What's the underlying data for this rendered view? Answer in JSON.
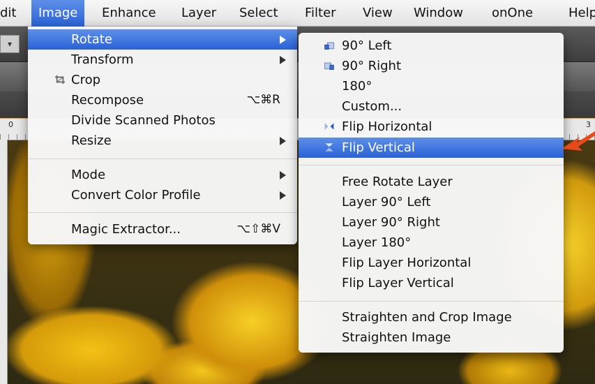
{
  "menubar": {
    "items": [
      "dit",
      "Image",
      "Enhance",
      "Layer",
      "Select",
      "Filter",
      "View",
      "Window",
      "onOne",
      "Help"
    ],
    "active": "Image"
  },
  "ruler": {
    "left_number": "0",
    "right_number": "3"
  },
  "image_menu": {
    "rotate": "Rotate",
    "transform": "Transform",
    "crop": "Crop",
    "recompose": "Recompose",
    "recompose_shortcut": "⌥⌘R",
    "divide_scanned": "Divide Scanned Photos",
    "resize": "Resize",
    "mode": "Mode",
    "convert_color_profile": "Convert Color Profile",
    "magic_extractor": "Magic Extractor...",
    "magic_extractor_shortcut": "⌥⇧⌘V"
  },
  "rotate_menu": {
    "left_90": "90° Left",
    "right_90": "90° Right",
    "r180": "180°",
    "custom": "Custom...",
    "flip_horizontal": "Flip Horizontal",
    "flip_vertical": "Flip Vertical",
    "free_rotate_layer": "Free Rotate Layer",
    "layer_90_left": "Layer 90° Left",
    "layer_90_right": "Layer 90° Right",
    "layer_180": "Layer 180°",
    "flip_layer_horizontal": "Flip Layer Horizontal",
    "flip_layer_vertical": "Flip Layer Vertical",
    "straighten_and_crop": "Straighten and Crop Image",
    "straighten_image": "Straighten Image"
  },
  "colors": {
    "highlight": "#2a62d6",
    "arrow": "#e8491b"
  }
}
